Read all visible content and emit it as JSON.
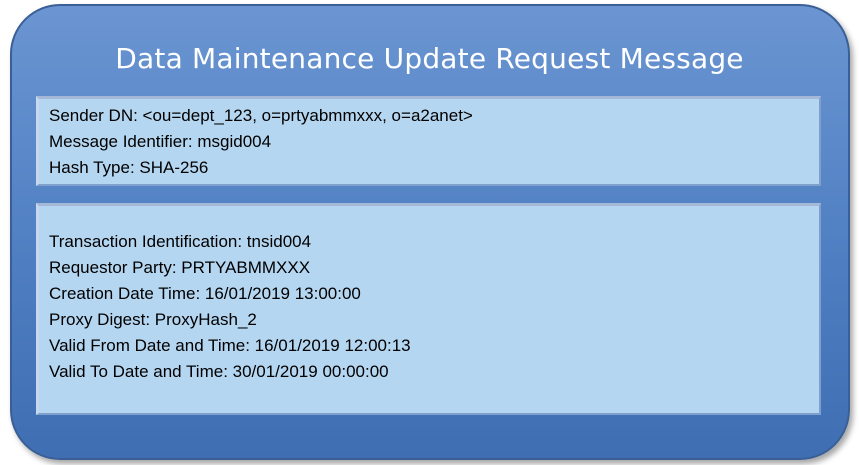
{
  "title": "Data Maintenance Update Request Message",
  "header": {
    "sender_dn": "Sender DN: <ou=dept_123, o=prtyabmmxxx, o=a2anet>",
    "message_identifier": "Message Identifier: msgid004",
    "hash_type": "Hash Type: SHA-256"
  },
  "body": {
    "transaction_identification": "Transaction Identification: tnsid004",
    "requestor_party": "Requestor Party: PRTYABMMXXX",
    "creation_date_time": "Creation Date Time: 16/01/2019 13:00:00",
    "proxy_digest": "Proxy Digest: ProxyHash_2",
    "valid_from": "Valid From Date and Time: 16/01/2019 12:00:13",
    "valid_to": "Valid To Date and Time: 30/01/2019 00:00:00"
  }
}
